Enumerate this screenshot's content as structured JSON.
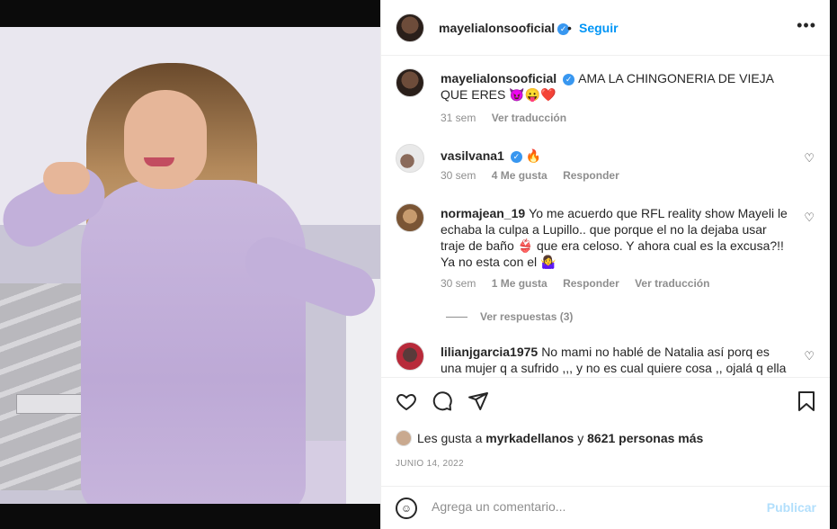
{
  "post": {
    "author": "mayelialonsooficial",
    "follow_dot": "•",
    "follow_label": "Seguir",
    "more_label": "•••"
  },
  "caption": {
    "user": "mayelialonsooficial",
    "text": "AMA LA CHINGONERIA DE VIEJA QUE ERES 😈😛❤️",
    "time": "31 sem",
    "translate": "Ver traducción"
  },
  "comments": [
    {
      "user": "vasilvana1",
      "text": "🔥",
      "time": "30 sem",
      "likes": "4 Me gusta",
      "reply": "Responder"
    },
    {
      "user": "normajean_19",
      "text": "Yo me acuerdo que RFL reality show Mayeli le echaba la culpa a Lupillo.. que porque el no la dejaba usar traje de baño 👙 que era celoso. Y ahora cual es la excusa?!! Ya no esta con el 🤷‍♀️",
      "time": "30 sem",
      "likes": "1 Me gusta",
      "reply": "Responder",
      "translate": "Ver traducción"
    },
    {
      "user": "lilianjgarcia1975",
      "text": "No mami no hablé de Natalia así porq es una mujer q a sufrido ,,, y no es cual quiere cosa ,, ojalá q ella gane"
    }
  ],
  "replies_label": "Ver respuestas (3)",
  "likes": {
    "prefix": "Les gusta a",
    "user": "myrkadellanos",
    "joiner": "y",
    "count": "8621 personas más"
  },
  "date": "JUNIO 14, 2022",
  "composer": {
    "placeholder": "Agrega un comentario...",
    "publish": "Publicar"
  },
  "icons": [
    "verified-badge",
    "more-options-icon",
    "heart-icon",
    "comment-icon",
    "share-icon",
    "bookmark-icon",
    "emoji-icon"
  ],
  "colors": {
    "accent": "#0095f6",
    "verified": "#3897f0",
    "muted": "#8e8e8e",
    "text": "#262626",
    "publish_disabled": "#b2dffc"
  }
}
